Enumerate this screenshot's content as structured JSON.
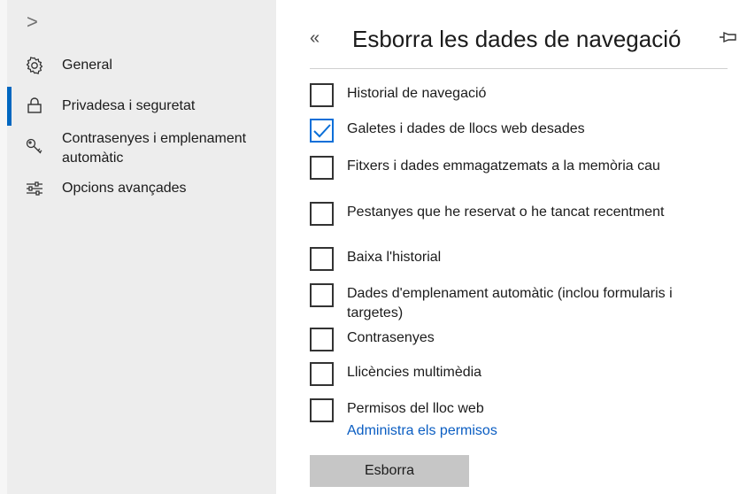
{
  "sidebar": {
    "expand_glyph": ">",
    "items": [
      {
        "label": "General",
        "icon": "gear-icon"
      },
      {
        "label": "Privadesa i seguretat",
        "icon": "lock-icon",
        "active": true
      },
      {
        "label": "Contrasenyes i emplenament automàtic",
        "icon": "key-icon"
      },
      {
        "label": "Opcions avançades",
        "icon": "sliders-icon"
      }
    ]
  },
  "panel": {
    "back_glyph": "«",
    "title": "Esborra les dades de navegació",
    "options": [
      {
        "label": "Historial de navegació",
        "checked": false
      },
      {
        "label": "Galetes i dades de llocs web desades",
        "checked": true
      },
      {
        "label": "Fitxers i dades emmagatzemats a la memòria cau",
        "checked": false
      },
      {
        "label": "Pestanyes que he reservat o he tancat recentment",
        "checked": false
      },
      {
        "label": "Baixa l'historial",
        "checked": false
      },
      {
        "label": "Dades d'emplenament automàtic (inclou formularis i targetes)",
        "checked": false
      },
      {
        "label": "Contrasenyes",
        "checked": false
      },
      {
        "label": "Llicències multimèdia",
        "checked": false
      },
      {
        "label": "Permisos del lloc web",
        "checked": false
      }
    ],
    "manage_link": "Administra els permisos",
    "clear_button": "Esborra"
  },
  "colors": {
    "accent": "#0067c0",
    "link": "#0a5dc2",
    "check": "#0a6fd8",
    "sidebar_bg": "#ededed",
    "button_bg": "#c6c6c6"
  }
}
